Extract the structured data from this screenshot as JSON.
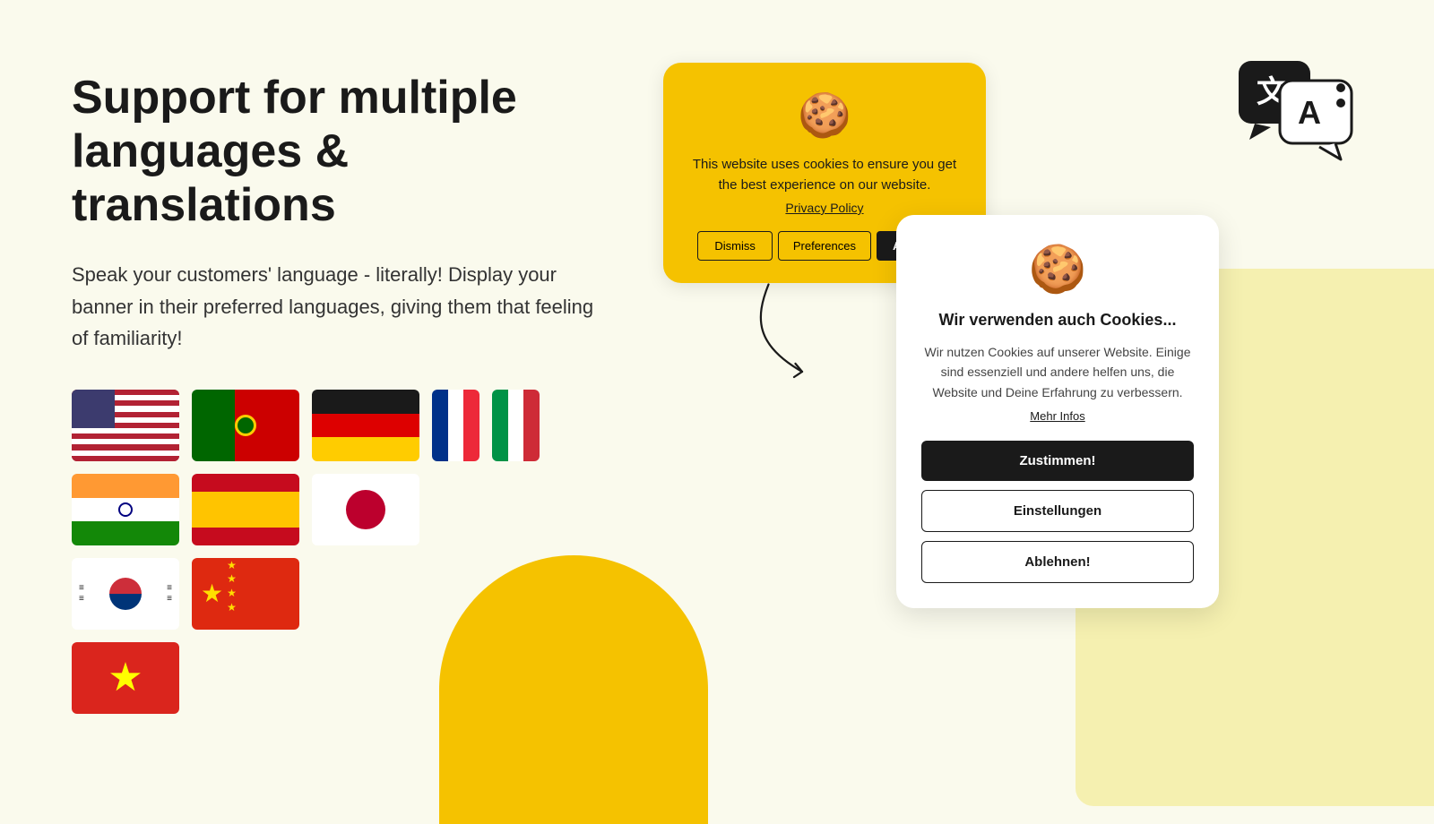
{
  "page": {
    "background_color": "#fafaed"
  },
  "left": {
    "title": "Support for multiple languages & translations",
    "subtitle": "Speak your customers' language - literally! Display your banner in their preferred languages, giving them that feeling of familiarity!"
  },
  "cookie_banner_en": {
    "cookie_icon": "🍪",
    "text": "This website uses cookies to ensure you get the best experience on our website.",
    "privacy_link": "Privacy Policy",
    "btn_dismiss": "Dismiss",
    "btn_preferences": "Preferences",
    "btn_accept": "Accept!"
  },
  "cookie_banner_de": {
    "cookie_icon": "🍪",
    "title": "Wir verwenden auch Cookies...",
    "text": "Wir nutzen Cookies auf unserer Website. Einige sind essenziell und andere helfen uns, die Website und Deine Erfahrung zu verbessern.",
    "more_link": "Mehr Infos",
    "btn_accept": "Zustimmen!",
    "btn_settings": "Einstellungen",
    "btn_reject": "Ablehnen!"
  },
  "flags": [
    {
      "name": "usa",
      "label": "USA"
    },
    {
      "name": "portugal",
      "label": "Portugal"
    },
    {
      "name": "germany",
      "label": "Germany"
    },
    {
      "name": "france-italy",
      "label": "France & Italy"
    },
    {
      "name": "india",
      "label": "India"
    },
    {
      "name": "spain",
      "label": "Spain"
    },
    {
      "name": "japan",
      "label": "Japan"
    },
    {
      "name": "korea",
      "label": "South Korea"
    },
    {
      "name": "china",
      "label": "China"
    },
    {
      "name": "vietnam",
      "label": "Vietnam"
    }
  ]
}
